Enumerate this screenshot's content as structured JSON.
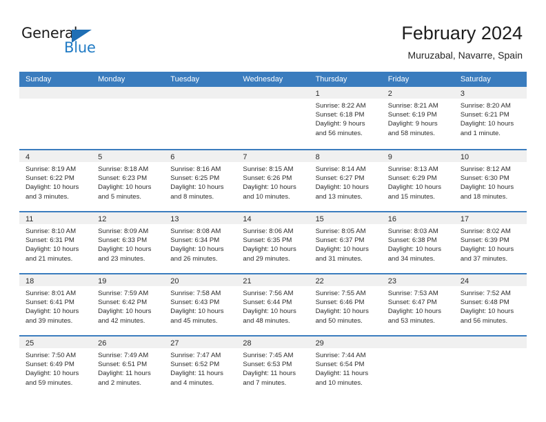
{
  "brand": {
    "word_top": "General",
    "word_bottom": "Blue",
    "triangle_color": "#1f6fb5",
    "blue_color": "#1f7ac4"
  },
  "header": {
    "title": "February 2024",
    "subtitle": "Muruzabal, Navarre, Spain"
  },
  "theme": {
    "header_blue": "#3a7cbe",
    "day_band_gray": "#f0f0f0",
    "text": "#2b2b2b"
  },
  "weekdays": [
    "Sunday",
    "Monday",
    "Tuesday",
    "Wednesday",
    "Thursday",
    "Friday",
    "Saturday"
  ],
  "weeks": [
    [
      {
        "day": "",
        "lines": []
      },
      {
        "day": "",
        "lines": []
      },
      {
        "day": "",
        "lines": []
      },
      {
        "day": "",
        "lines": []
      },
      {
        "day": "1",
        "lines": [
          "Sunrise: 8:22 AM",
          "Sunset: 6:18 PM",
          "Daylight: 9 hours",
          "and 56 minutes."
        ]
      },
      {
        "day": "2",
        "lines": [
          "Sunrise: 8:21 AM",
          "Sunset: 6:19 PM",
          "Daylight: 9 hours",
          "and 58 minutes."
        ]
      },
      {
        "day": "3",
        "lines": [
          "Sunrise: 8:20 AM",
          "Sunset: 6:21 PM",
          "Daylight: 10 hours",
          "and 1 minute."
        ]
      }
    ],
    [
      {
        "day": "4",
        "lines": [
          "Sunrise: 8:19 AM",
          "Sunset: 6:22 PM",
          "Daylight: 10 hours",
          "and 3 minutes."
        ]
      },
      {
        "day": "5",
        "lines": [
          "Sunrise: 8:18 AM",
          "Sunset: 6:23 PM",
          "Daylight: 10 hours",
          "and 5 minutes."
        ]
      },
      {
        "day": "6",
        "lines": [
          "Sunrise: 8:16 AM",
          "Sunset: 6:25 PM",
          "Daylight: 10 hours",
          "and 8 minutes."
        ]
      },
      {
        "day": "7",
        "lines": [
          "Sunrise: 8:15 AM",
          "Sunset: 6:26 PM",
          "Daylight: 10 hours",
          "and 10 minutes."
        ]
      },
      {
        "day": "8",
        "lines": [
          "Sunrise: 8:14 AM",
          "Sunset: 6:27 PM",
          "Daylight: 10 hours",
          "and 13 minutes."
        ]
      },
      {
        "day": "9",
        "lines": [
          "Sunrise: 8:13 AM",
          "Sunset: 6:29 PM",
          "Daylight: 10 hours",
          "and 15 minutes."
        ]
      },
      {
        "day": "10",
        "lines": [
          "Sunrise: 8:12 AM",
          "Sunset: 6:30 PM",
          "Daylight: 10 hours",
          "and 18 minutes."
        ]
      }
    ],
    [
      {
        "day": "11",
        "lines": [
          "Sunrise: 8:10 AM",
          "Sunset: 6:31 PM",
          "Daylight: 10 hours",
          "and 21 minutes."
        ]
      },
      {
        "day": "12",
        "lines": [
          "Sunrise: 8:09 AM",
          "Sunset: 6:33 PM",
          "Daylight: 10 hours",
          "and 23 minutes."
        ]
      },
      {
        "day": "13",
        "lines": [
          "Sunrise: 8:08 AM",
          "Sunset: 6:34 PM",
          "Daylight: 10 hours",
          "and 26 minutes."
        ]
      },
      {
        "day": "14",
        "lines": [
          "Sunrise: 8:06 AM",
          "Sunset: 6:35 PM",
          "Daylight: 10 hours",
          "and 29 minutes."
        ]
      },
      {
        "day": "15",
        "lines": [
          "Sunrise: 8:05 AM",
          "Sunset: 6:37 PM",
          "Daylight: 10 hours",
          "and 31 minutes."
        ]
      },
      {
        "day": "16",
        "lines": [
          "Sunrise: 8:03 AM",
          "Sunset: 6:38 PM",
          "Daylight: 10 hours",
          "and 34 minutes."
        ]
      },
      {
        "day": "17",
        "lines": [
          "Sunrise: 8:02 AM",
          "Sunset: 6:39 PM",
          "Daylight: 10 hours",
          "and 37 minutes."
        ]
      }
    ],
    [
      {
        "day": "18",
        "lines": [
          "Sunrise: 8:01 AM",
          "Sunset: 6:41 PM",
          "Daylight: 10 hours",
          "and 39 minutes."
        ]
      },
      {
        "day": "19",
        "lines": [
          "Sunrise: 7:59 AM",
          "Sunset: 6:42 PM",
          "Daylight: 10 hours",
          "and 42 minutes."
        ]
      },
      {
        "day": "20",
        "lines": [
          "Sunrise: 7:58 AM",
          "Sunset: 6:43 PM",
          "Daylight: 10 hours",
          "and 45 minutes."
        ]
      },
      {
        "day": "21",
        "lines": [
          "Sunrise: 7:56 AM",
          "Sunset: 6:44 PM",
          "Daylight: 10 hours",
          "and 48 minutes."
        ]
      },
      {
        "day": "22",
        "lines": [
          "Sunrise: 7:55 AM",
          "Sunset: 6:46 PM",
          "Daylight: 10 hours",
          "and 50 minutes."
        ]
      },
      {
        "day": "23",
        "lines": [
          "Sunrise: 7:53 AM",
          "Sunset: 6:47 PM",
          "Daylight: 10 hours",
          "and 53 minutes."
        ]
      },
      {
        "day": "24",
        "lines": [
          "Sunrise: 7:52 AM",
          "Sunset: 6:48 PM",
          "Daylight: 10 hours",
          "and 56 minutes."
        ]
      }
    ],
    [
      {
        "day": "25",
        "lines": [
          "Sunrise: 7:50 AM",
          "Sunset: 6:49 PM",
          "Daylight: 10 hours",
          "and 59 minutes."
        ]
      },
      {
        "day": "26",
        "lines": [
          "Sunrise: 7:49 AM",
          "Sunset: 6:51 PM",
          "Daylight: 11 hours",
          "and 2 minutes."
        ]
      },
      {
        "day": "27",
        "lines": [
          "Sunrise: 7:47 AM",
          "Sunset: 6:52 PM",
          "Daylight: 11 hours",
          "and 4 minutes."
        ]
      },
      {
        "day": "28",
        "lines": [
          "Sunrise: 7:45 AM",
          "Sunset: 6:53 PM",
          "Daylight: 11 hours",
          "and 7 minutes."
        ]
      },
      {
        "day": "29",
        "lines": [
          "Sunrise: 7:44 AM",
          "Sunset: 6:54 PM",
          "Daylight: 11 hours",
          "and 10 minutes."
        ]
      },
      {
        "day": "",
        "lines": []
      },
      {
        "day": "",
        "lines": []
      }
    ]
  ]
}
